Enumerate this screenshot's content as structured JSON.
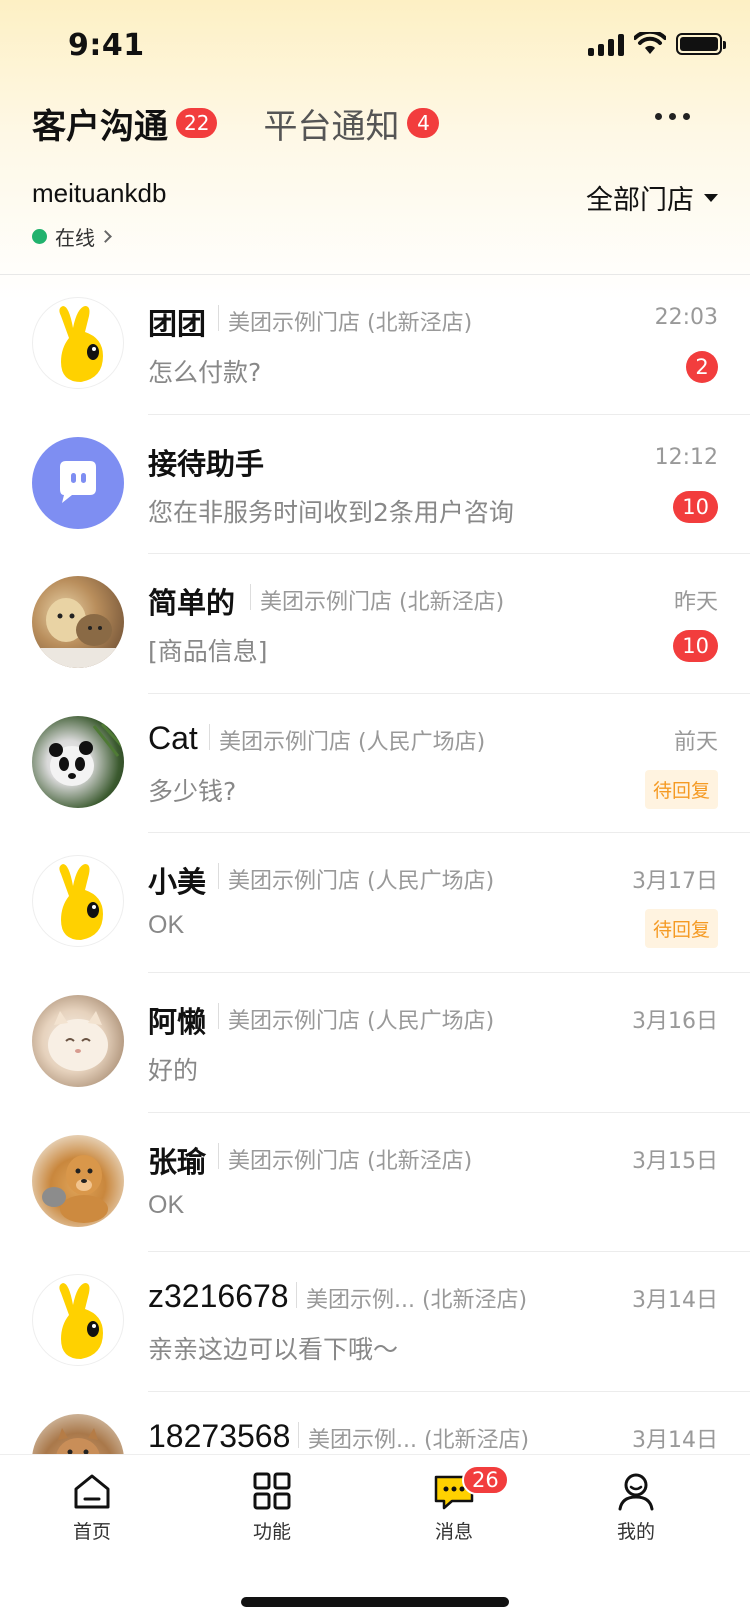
{
  "status": {
    "time": "9:41"
  },
  "tabs": [
    {
      "label": "客户沟通",
      "badge": "22"
    },
    {
      "label": "平台通知",
      "badge": "4"
    }
  ],
  "account": {
    "name": "meituankdb",
    "status": "在线",
    "store_filter": "全部门店"
  },
  "conversations": [
    {
      "name": "团团",
      "store": "美团示例门店 (北新泾店)",
      "time": "22:03",
      "preview": "怎么付款?",
      "badge": "2",
      "badge_type": "count",
      "avatar": "mascot-icon"
    },
    {
      "name": "接待助手",
      "store": "",
      "time": "12:12",
      "preview": "您在非服务时间收到2条用户咨询",
      "badge": "10",
      "badge_type": "count",
      "avatar": "bot-icon"
    },
    {
      "name": "简单的",
      "store": "美团示例门店 (北新泾店)",
      "time": "昨天",
      "preview": "[商品信息]",
      "badge": "10",
      "badge_type": "count",
      "avatar": "dog-cat-photo"
    },
    {
      "name": "Cat",
      "store": "美团示例门店 (人民广场店)",
      "time": "前天",
      "preview": "多少钱?",
      "badge": "待回复",
      "badge_type": "pending",
      "avatar": "panda-photo"
    },
    {
      "name": "小美",
      "store": "美团示例门店 (人民广场店)",
      "time": "3月17日",
      "preview": "OK",
      "badge": "待回复",
      "badge_type": "pending",
      "avatar": "mascot-icon"
    },
    {
      "name": "阿懒",
      "store": "美团示例门店 (人民广场店)",
      "time": "3月16日",
      "preview": "好的",
      "badge": "",
      "badge_type": "none",
      "avatar": "cat-photo"
    },
    {
      "name": "张瑜",
      "store": "美团示例门店 (北新泾店)",
      "time": "3月15日",
      "preview": "OK",
      "badge": "",
      "badge_type": "none",
      "avatar": "dog-photo"
    },
    {
      "name": "z3216678",
      "store": "美团示例... (北新泾店)",
      "time": "3月14日",
      "preview": "亲亲这边可以看下哦～",
      "badge": "",
      "badge_type": "none",
      "avatar": "mascot-icon"
    },
    {
      "name": "18273568",
      "store": "美团示例... (北新泾店)",
      "time": "3月14日",
      "preview": "",
      "badge": "",
      "badge_type": "none",
      "avatar": "squirrel-photo"
    }
  ],
  "tabbar": [
    {
      "label": "首页",
      "icon": "home-icon"
    },
    {
      "label": "功能",
      "icon": "grid-icon"
    },
    {
      "label": "消息",
      "icon": "message-icon",
      "badge": "26"
    },
    {
      "label": "我的",
      "icon": "profile-icon"
    }
  ],
  "colors": {
    "accent_red": "#f23d3d",
    "online_green": "#21b26d",
    "pending_orange": "#f59a23",
    "brand_yellow": "#ffd100"
  }
}
